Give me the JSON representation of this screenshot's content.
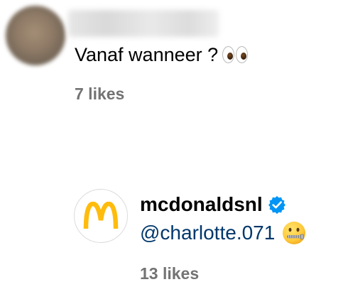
{
  "comment": {
    "text": "Vanaf wanneer ?",
    "emoji_icon": "eyes-icon",
    "likes": "7 likes"
  },
  "reply": {
    "username": "mcdonaldsnl",
    "verified_icon": "verified-badge-icon",
    "mention": "@charlotte.071",
    "emoji_icon": "zipper-mouth-face-icon",
    "likes": "13 likes",
    "brand_color": "#FFBC0D",
    "verified_color": "#0095F6",
    "mention_color": "#00376B"
  },
  "colors": {
    "likes_text": "#737373"
  }
}
